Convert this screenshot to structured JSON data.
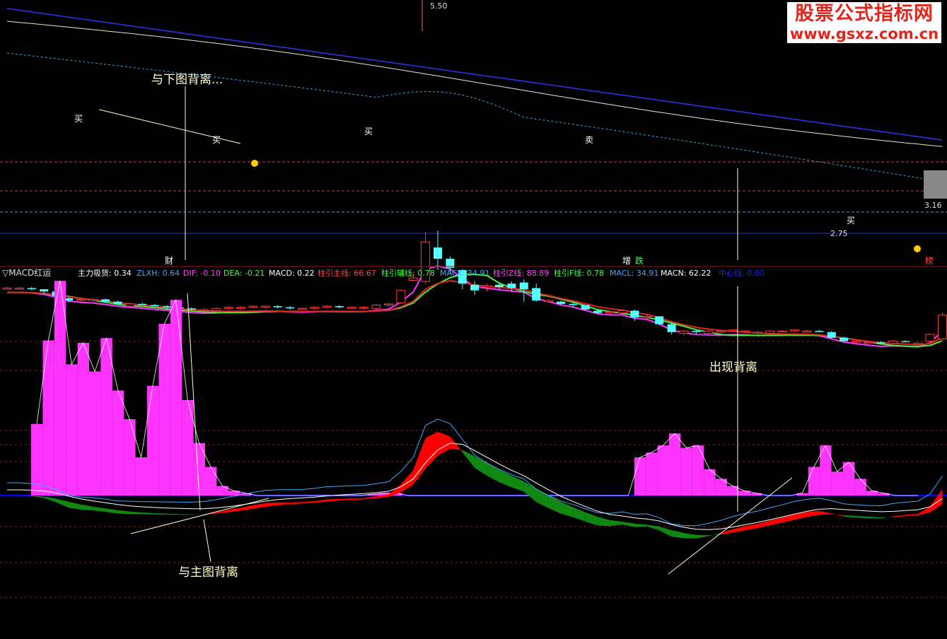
{
  "app": {
    "watermark_title": "股票公式指标网",
    "watermark_url": "www.gsxz.com.cn"
  },
  "colors": {
    "background": "#000000",
    "up_candle": "#ff3b3b",
    "down_candle": "#54ffff",
    "ma_fast": "#ff33ff",
    "ma_mid": "#44ee44",
    "ma_slow": "#dd2222",
    "ma_white": "#e8e8d0",
    "ma_blue": "#3333ee",
    "ma_dotted": "#33aadd",
    "hist": "#ff33ff",
    "band_red": "#ff0000",
    "band_green": "#118811",
    "zero_line": "#0000ff"
  },
  "indicator_header": {
    "name": "▽MACD红运",
    "fields": [
      {
        "text": "主力吸货: 0.34",
        "color": "#ffffff"
      },
      {
        "text": "ZLXH: 0.64",
        "color": "#3fa9ff"
      },
      {
        "text": "DIF: -0.10",
        "color": "#ff44ff"
      },
      {
        "text": "DEA: -0.21",
        "color": "#44ff44"
      },
      {
        "text": "MACD: 0.22",
        "color": "#ffffff"
      },
      {
        "text": "柱引主线: 66.67",
        "color": "#ff4444"
      },
      {
        "text": "柱引辅线: 0.78",
        "color": "#44ff44"
      },
      {
        "text": "MACK: 34.91",
        "color": "#3fa9ff"
      },
      {
        "text": "柱引Z线: 88.89",
        "color": "#ff44ff"
      },
      {
        "text": "柱引F线: 0.78",
        "color": "#44ff44"
      },
      {
        "text": "MACL: 34.91",
        "color": "#3fa9ff"
      },
      {
        "text": "MACN: 62.22",
        "color": "#ffffff"
      },
      {
        "text": "中心线: 0.00",
        "color": "#2222ff"
      }
    ]
  },
  "main_chart": {
    "price_labels": [
      "5.50",
      "3.16",
      "2.75"
    ],
    "annotation": "与下图背离...",
    "buy_label": "买",
    "sell_label": "卖",
    "axis_markers": [
      "财",
      "增",
      "跌",
      "榜"
    ]
  },
  "sub_chart": {
    "annotation_right": "出现背离",
    "annotation_bottom": "与主图背离"
  },
  "chart_data": {
    "type": "candlestick",
    "candles": [
      [
        2.98,
        3.0,
        2.99,
        2.99
      ],
      [
        2.99,
        3.0,
        2.98,
        2.99
      ],
      [
        2.99,
        3.0,
        2.97,
        2.98
      ],
      [
        2.98,
        2.98,
        2.94,
        2.96
      ],
      [
        2.96,
        2.97,
        2.9,
        2.92
      ],
      [
        2.9,
        2.91,
        2.86,
        2.88
      ],
      [
        2.88,
        2.9,
        2.87,
        2.89
      ],
      [
        2.88,
        2.9,
        2.87,
        2.89
      ],
      [
        2.89,
        2.9,
        2.86,
        2.87
      ],
      [
        2.87,
        2.88,
        2.84,
        2.85
      ],
      [
        2.83,
        2.86,
        2.82,
        2.85
      ],
      [
        2.85,
        2.86,
        2.84,
        2.84
      ],
      [
        2.84,
        2.85,
        2.83,
        2.83
      ],
      [
        2.83,
        2.84,
        2.81,
        2.82
      ],
      [
        2.82,
        2.82,
        2.8,
        2.81
      ],
      [
        2.81,
        2.82,
        2.79,
        2.8
      ],
      [
        2.8,
        2.81,
        2.79,
        2.8
      ],
      [
        2.79,
        2.82,
        2.78,
        2.81
      ],
      [
        2.81,
        2.83,
        2.8,
        2.82
      ],
      [
        2.81,
        2.83,
        2.8,
        2.82
      ],
      [
        2.82,
        2.83,
        2.81,
        2.83
      ],
      [
        2.82,
        2.83,
        2.81,
        2.83
      ],
      [
        2.83,
        2.84,
        2.81,
        2.82
      ],
      [
        2.82,
        2.83,
        2.8,
        2.81
      ],
      [
        2.81,
        2.82,
        2.8,
        2.81
      ],
      [
        2.81,
        2.83,
        2.8,
        2.82
      ],
      [
        2.82,
        2.84,
        2.81,
        2.83
      ],
      [
        2.83,
        2.84,
        2.81,
        2.82
      ],
      [
        2.82,
        2.83,
        2.81,
        2.82
      ],
      [
        2.82,
        2.83,
        2.8,
        2.82
      ],
      [
        2.81,
        2.85,
        2.8,
        2.84
      ],
      [
        2.84,
        2.86,
        2.82,
        2.85
      ],
      [
        2.86,
        2.98,
        2.85,
        2.97
      ],
      [
        3.06,
        3.12,
        3.05,
        3.08
      ],
      [
        3.05,
        3.49,
        3.03,
        3.4
      ],
      [
        3.35,
        3.5,
        3.15,
        3.25
      ],
      [
        3.25,
        3.27,
        3.12,
        3.17
      ],
      [
        3.15,
        3.16,
        2.98,
        3.03
      ],
      [
        3.02,
        3.05,
        2.93,
        2.97
      ],
      [
        3.0,
        3.03,
        2.96,
        3.01
      ],
      [
        3.02,
        3.04,
        2.98,
        3.0
      ],
      [
        3.03,
        3.05,
        2.96,
        2.99
      ],
      [
        3.04,
        3.07,
        2.87,
        2.98
      ],
      [
        2.99,
        3.03,
        2.87,
        2.88
      ],
      [
        2.87,
        2.89,
        2.86,
        2.88
      ],
      [
        2.87,
        2.88,
        2.84,
        2.85
      ],
      [
        2.85,
        2.86,
        2.82,
        2.84
      ],
      [
        2.84,
        2.84,
        2.79,
        2.8
      ],
      [
        2.79,
        2.8,
        2.76,
        2.77
      ],
      [
        2.78,
        2.79,
        2.76,
        2.78
      ],
      [
        2.77,
        2.8,
        2.76,
        2.79
      ],
      [
        2.79,
        2.8,
        2.7,
        2.73
      ],
      [
        2.73,
        2.76,
        2.72,
        2.74
      ],
      [
        2.74,
        2.74,
        2.66,
        2.67
      ],
      [
        2.67,
        2.69,
        2.58,
        2.6
      ],
      [
        2.59,
        2.62,
        2.57,
        2.61
      ],
      [
        2.61,
        2.62,
        2.58,
        2.6
      ],
      [
        2.59,
        2.62,
        2.57,
        2.61
      ],
      [
        2.6,
        2.62,
        2.59,
        2.61
      ],
      [
        2.61,
        2.62,
        2.6,
        2.62
      ],
      [
        2.61,
        2.62,
        2.6,
        2.61
      ],
      [
        2.6,
        2.61,
        2.58,
        2.6
      ],
      [
        2.59,
        2.62,
        2.58,
        2.61
      ],
      [
        2.61,
        2.62,
        2.6,
        2.61
      ],
      [
        2.61,
        2.62,
        2.6,
        2.62
      ],
      [
        2.61,
        2.62,
        2.6,
        2.61
      ],
      [
        2.61,
        2.62,
        2.6,
        2.6
      ],
      [
        2.6,
        2.61,
        2.54,
        2.55
      ],
      [
        2.55,
        2.56,
        2.51,
        2.52
      ],
      [
        2.51,
        2.53,
        2.5,
        2.52
      ],
      [
        2.51,
        2.52,
        2.5,
        2.51
      ],
      [
        2.51,
        2.52,
        2.49,
        2.5
      ],
      [
        2.5,
        2.53,
        2.49,
        2.52
      ],
      [
        2.52,
        2.53,
        2.51,
        2.51
      ],
      [
        2.5,
        2.51,
        2.49,
        2.5
      ],
      [
        2.52,
        2.59,
        2.51,
        2.58
      ],
      [
        2.54,
        2.77,
        2.53,
        2.75
      ]
    ],
    "histogram": [
      1.5,
      3.25,
      4.5,
      2.75,
      3.2,
      2.6,
      3.3,
      2.2,
      1.6,
      0.8,
      2.3,
      3.6,
      4.1,
      2.0,
      1.1,
      0.6,
      0.2,
      0.1,
      0.05,
      0,
      0,
      0,
      0,
      0,
      0,
      0,
      0,
      0,
      0,
      0.03,
      0.05,
      0.05,
      0,
      0,
      0,
      0,
      0,
      0,
      0,
      0,
      0,
      0,
      0,
      0,
      0,
      0,
      0,
      0,
      0,
      0,
      0,
      0,
      0.8,
      0.9,
      1.05,
      1.3,
      1.0,
      1.05,
      0.55,
      0.35,
      0.2,
      0.1,
      0.05,
      0,
      0,
      0,
      0.05,
      0.6,
      1.05,
      0.5,
      0.7,
      0.35,
      0.1,
      0.05,
      0,
      0,
      0
    ]
  }
}
